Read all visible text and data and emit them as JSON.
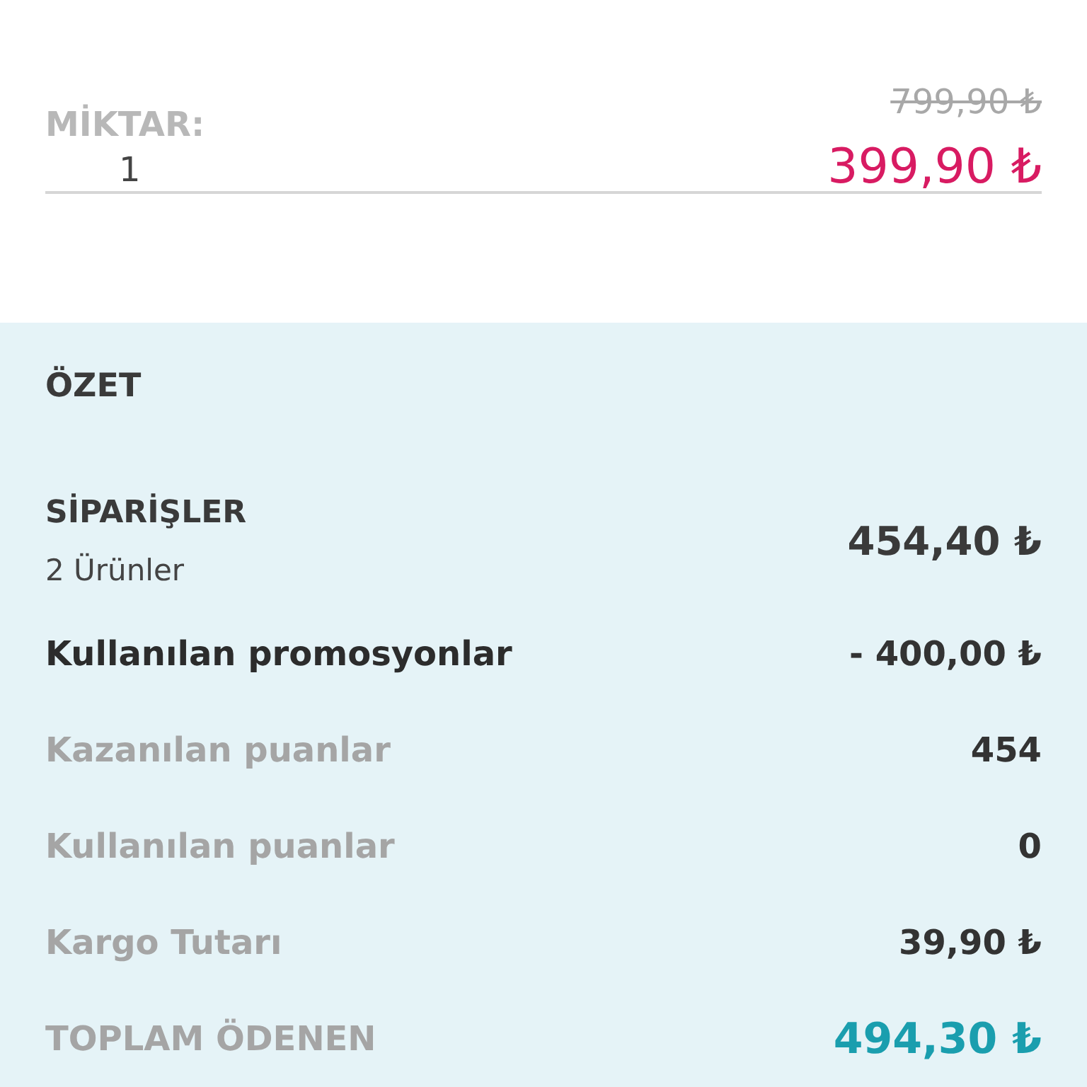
{
  "item": {
    "quantity_label": "MİKTAR:",
    "quantity": "1",
    "old_price": "799,90 ₺",
    "price": "399,90 ₺"
  },
  "summary": {
    "title": "ÖZET",
    "orders": {
      "label": "SİPARİŞLER",
      "count": "2 Ürünler",
      "amount": "454,40 ₺"
    },
    "rows": [
      {
        "kind": "emphasis",
        "label": "Kullanılan promosyonlar",
        "value": "- 400,00 ₺"
      },
      {
        "kind": "muted",
        "label": "Kazanılan puanlar",
        "value": "454"
      },
      {
        "kind": "muted",
        "label": "Kullanılan puanlar",
        "value": "0"
      },
      {
        "kind": "muted",
        "label": "Kargo Tutarı",
        "value": "39,90 ₺"
      },
      {
        "kind": "total",
        "label": "TOPLAM ÖDENEN",
        "value": "494,30 ₺"
      }
    ]
  }
}
